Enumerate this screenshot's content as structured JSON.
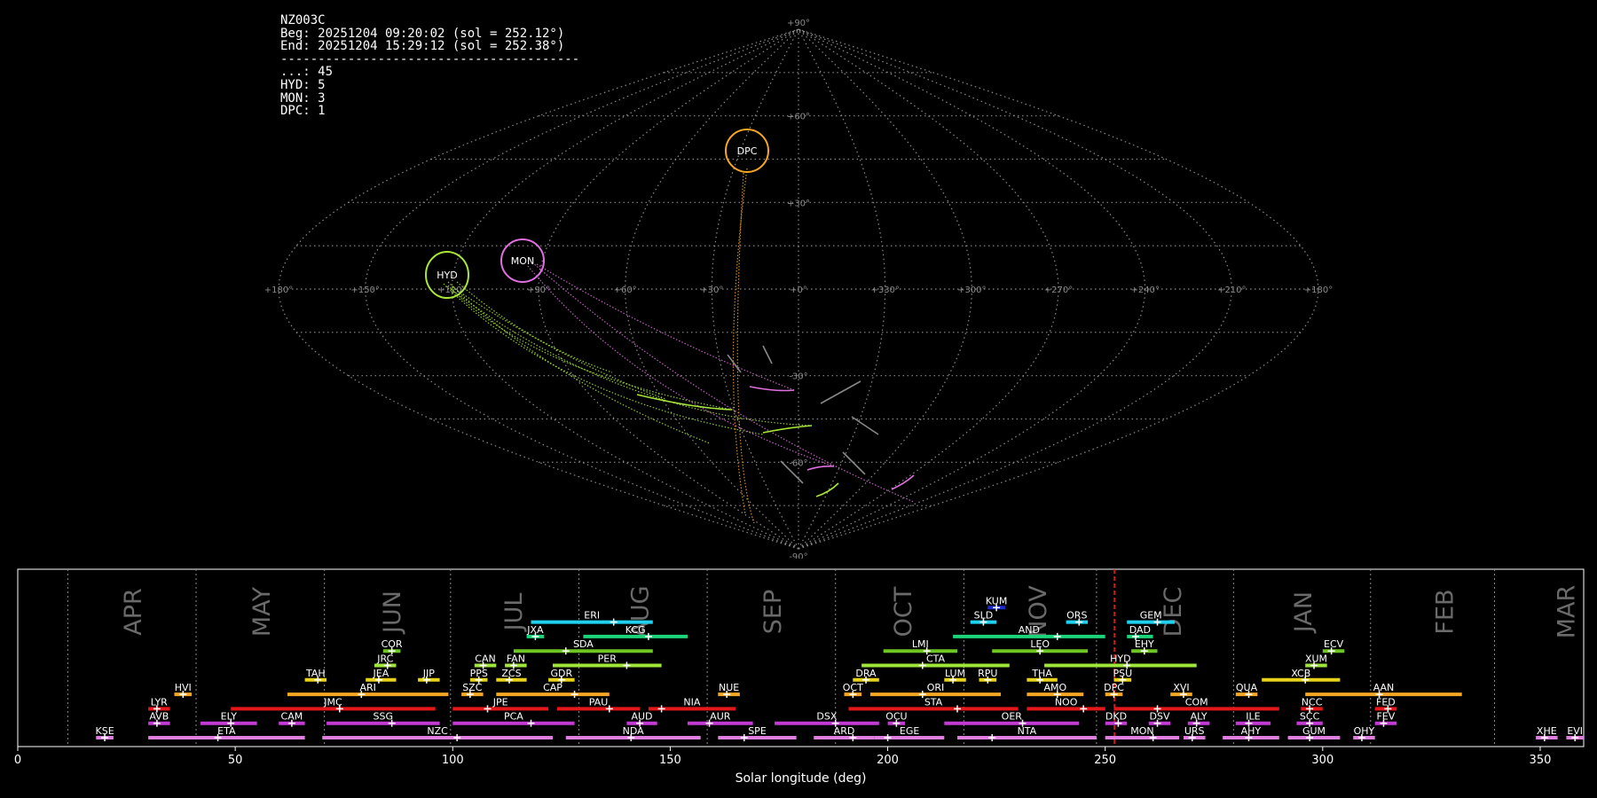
{
  "info": {
    "station": "NZ003C",
    "begin": "Beg: 20251204 09:20:02 (sol = 252.12°)",
    "end": "End: 20251204 15:29:12 (sol = 252.38°)",
    "separator": "----------------------------------------",
    "counts": [
      {
        "code": "...",
        "count": 45
      },
      {
        "code": "HYD",
        "count": 5
      },
      {
        "code": "MON",
        "count": 3
      },
      {
        "code": "DPC",
        "count": 1
      }
    ]
  },
  "sky_map": {
    "projection": "sinusoidal",
    "lon_labels": [
      "+180°",
      "+150°",
      "+120°",
      "+90°",
      "+60°",
      "+30°",
      "+0°",
      "+330°",
      "+300°",
      "+270°",
      "+240°",
      "+210°",
      "+180°"
    ],
    "lat_labels": [
      "+90°",
      "+60°",
      "+30°",
      "-30°",
      "-60°",
      "-90°"
    ],
    "radiants": [
      {
        "code": "HYD",
        "lon": 120,
        "lat": 5,
        "color": "#a8e63a"
      },
      {
        "code": "MON",
        "lon": 93,
        "lat": 15,
        "color": "#e070e0"
      },
      {
        "code": "DPC",
        "lon": 20,
        "lat": 54,
        "color": "#f5a623"
      }
    ]
  },
  "chart_data": {
    "type": "timeline",
    "xlabel": "Solar longitude (deg)",
    "xlim": [
      0,
      360
    ],
    "xticks": [
      0,
      50,
      100,
      150,
      200,
      250,
      300,
      350
    ],
    "current_sol": 252.12,
    "months": [
      {
        "label": "APR",
        "start": 11.5,
        "mid": 24.5
      },
      {
        "label": "MAY",
        "start": 41,
        "mid": 54
      },
      {
        "label": "JUN",
        "start": 70.5,
        "mid": 84
      },
      {
        "label": "JUL",
        "start": 99.5,
        "mid": 112
      },
      {
        "label": "AUG",
        "start": 129,
        "mid": 141
      },
      {
        "label": "SEP",
        "start": 158.5,
        "mid": 171.5
      },
      {
        "label": "OCT",
        "start": 188,
        "mid": 201.5
      },
      {
        "label": "NOV",
        "start": 217.5,
        "mid": 232.5
      },
      {
        "label": "DEC",
        "start": 248,
        "mid": 263.5
      },
      {
        "label": "JAN",
        "start": 279.5,
        "mid": 293.5
      },
      {
        "label": "FEB",
        "start": 311,
        "mid": 326
      },
      {
        "label": "MAR",
        "start": 339.5,
        "mid": 354
      }
    ],
    "showers": [
      {
        "code": "KUM",
        "row": 9,
        "start": 223,
        "end": 227,
        "peak": 225,
        "color": "#1c2bd6"
      },
      {
        "code": "ERI",
        "row": 8,
        "start": 118,
        "end": 146,
        "peak": 137,
        "color": "#1fd3f0"
      },
      {
        "code": "SLD",
        "row": 8,
        "start": 219,
        "end": 225,
        "peak": 222,
        "color": "#1fd3f0"
      },
      {
        "code": "ORS",
        "row": 8,
        "start": 241,
        "end": 246,
        "peak": 244,
        "color": "#1fd3f0"
      },
      {
        "code": "GEM",
        "row": 8,
        "start": 255,
        "end": 266,
        "peak": 262,
        "color": "#1fd3f0"
      },
      {
        "code": "JXA",
        "row": 7,
        "start": 117,
        "end": 121,
        "peak": 119,
        "color": "#1cd47a"
      },
      {
        "code": "KCG",
        "row": 7,
        "start": 130,
        "end": 154,
        "peak": 145,
        "color": "#1cd47a"
      },
      {
        "code": "AND",
        "row": 7,
        "start": 215,
        "end": 250,
        "peak": 239,
        "color": "#1cd47a"
      },
      {
        "code": "DAD",
        "row": 7,
        "start": 255,
        "end": 261,
        "peak": 257,
        "color": "#1cd47a"
      },
      {
        "code": "COR",
        "row": 6,
        "start": 84,
        "end": 88,
        "peak": 86,
        "color": "#6ec623"
      },
      {
        "code": "SDA",
        "row": 6,
        "start": 114,
        "end": 146,
        "peak": 126,
        "color": "#6ec623"
      },
      {
        "code": "LMI",
        "row": 6,
        "start": 199,
        "end": 216,
        "peak": 209,
        "color": "#6ec623"
      },
      {
        "code": "LEO",
        "row": 6,
        "start": 224,
        "end": 246,
        "peak": 235,
        "color": "#6ec623"
      },
      {
        "code": "EHY",
        "row": 6,
        "start": 256,
        "end": 262,
        "peak": 259,
        "color": "#6ec623"
      },
      {
        "code": "ECV",
        "row": 6,
        "start": 300,
        "end": 305,
        "peak": 302,
        "color": "#6ec623"
      },
      {
        "code": "JRC",
        "row": 5,
        "start": 82,
        "end": 87,
        "peak": 85,
        "color": "#9ee63a"
      },
      {
        "code": "CAN",
        "row": 5,
        "start": 105,
        "end": 110,
        "peak": 107,
        "color": "#9ee63a"
      },
      {
        "code": "FAN",
        "row": 5,
        "start": 112,
        "end": 117,
        "peak": 114,
        "color": "#9ee63a"
      },
      {
        "code": "PER",
        "row": 5,
        "start": 123,
        "end": 148,
        "peak": 140,
        "color": "#9ee63a"
      },
      {
        "code": "CTA",
        "row": 5,
        "start": 194,
        "end": 228,
        "peak": 208,
        "color": "#9ee63a"
      },
      {
        "code": "HYD",
        "row": 5,
        "start": 236,
        "end": 271,
        "peak": 255,
        "color": "#9ee63a"
      },
      {
        "code": "XUM",
        "row": 5,
        "start": 296,
        "end": 301,
        "peak": 298,
        "color": "#9ee63a"
      },
      {
        "code": "TAH",
        "row": 4,
        "start": 66,
        "end": 71,
        "peak": 69,
        "color": "#e8d21a"
      },
      {
        "code": "JEA",
        "row": 4,
        "start": 80,
        "end": 87,
        "peak": 83,
        "color": "#e8d21a"
      },
      {
        "code": "JIP",
        "row": 4,
        "start": 92,
        "end": 97,
        "peak": 94,
        "color": "#e8d21a"
      },
      {
        "code": "PPS",
        "row": 4,
        "start": 104,
        "end": 108,
        "peak": 106,
        "color": "#e8d21a"
      },
      {
        "code": "ZCS",
        "row": 4,
        "start": 110,
        "end": 117,
        "peak": 113,
        "color": "#e8d21a"
      },
      {
        "code": "GDR",
        "row": 4,
        "start": 122,
        "end": 128,
        "peak": 125,
        "color": "#e8d21a"
      },
      {
        "code": "DRA",
        "row": 4,
        "start": 192,
        "end": 198,
        "peak": 195,
        "color": "#e8d21a"
      },
      {
        "code": "LUM",
        "row": 4,
        "start": 213,
        "end": 218,
        "peak": 215,
        "color": "#e8d21a"
      },
      {
        "code": "RPU",
        "row": 4,
        "start": 221,
        "end": 225,
        "peak": 223,
        "color": "#e8d21a"
      },
      {
        "code": "THA",
        "row": 4,
        "start": 232,
        "end": 239,
        "peak": 235,
        "color": "#e8d21a"
      },
      {
        "code": "PSU",
        "row": 4,
        "start": 252,
        "end": 256,
        "peak": 254,
        "color": "#e8d21a"
      },
      {
        "code": "XCB",
        "row": 4,
        "start": 286,
        "end": 304,
        "peak": 296,
        "color": "#e8d21a"
      },
      {
        "code": "HVI",
        "row": 3,
        "start": 36,
        "end": 40,
        "peak": 38,
        "color": "#f5a623"
      },
      {
        "code": "ARI",
        "row": 3,
        "start": 62,
        "end": 99,
        "peak": 79,
        "color": "#f5a623"
      },
      {
        "code": "SZC",
        "row": 3,
        "start": 102,
        "end": 107,
        "peak": 104,
        "color": "#f5a623"
      },
      {
        "code": "CAP",
        "row": 3,
        "start": 110,
        "end": 136,
        "peak": 128,
        "color": "#f5a623"
      },
      {
        "code": "NUE",
        "row": 3,
        "start": 161,
        "end": 166,
        "peak": 163,
        "color": "#f5a623"
      },
      {
        "code": "OCT",
        "row": 3,
        "start": 190,
        "end": 194,
        "peak": 192,
        "color": "#f5a623"
      },
      {
        "code": "ORI",
        "row": 3,
        "start": 196,
        "end": 226,
        "peak": 208,
        "color": "#f5a623"
      },
      {
        "code": "AMO",
        "row": 3,
        "start": 232,
        "end": 245,
        "peak": 239,
        "color": "#f5a623"
      },
      {
        "code": "DPC",
        "row": 3,
        "start": 250,
        "end": 254,
        "peak": 252,
        "color": "#f5a623"
      },
      {
        "code": "XVI",
        "row": 3,
        "start": 265,
        "end": 270,
        "peak": 268,
        "color": "#f5a623"
      },
      {
        "code": "QUA",
        "row": 3,
        "start": 280,
        "end": 285,
        "peak": 283,
        "color": "#f5a623"
      },
      {
        "code": "AAN",
        "row": 3,
        "start": 296,
        "end": 332,
        "peak": 313,
        "color": "#f5a623"
      },
      {
        "code": "LYR",
        "row": 2,
        "start": 30,
        "end": 35,
        "peak": 32,
        "color": "#e5171b"
      },
      {
        "code": "JMC",
        "row": 2,
        "start": 49,
        "end": 96,
        "peak": 74,
        "color": "#e5171b"
      },
      {
        "code": "JPE",
        "row": 2,
        "start": 100,
        "end": 122,
        "peak": 108,
        "color": "#e5171b"
      },
      {
        "code": "PAU",
        "row": 2,
        "start": 124,
        "end": 143,
        "peak": 136,
        "color": "#e5171b"
      },
      {
        "code": "NIA",
        "row": 2,
        "start": 145,
        "end": 165,
        "peak": 148,
        "color": "#e5171b"
      },
      {
        "code": "STA",
        "row": 2,
        "start": 191,
        "end": 230,
        "peak": 216,
        "color": "#e5171b"
      },
      {
        "code": "NOO",
        "row": 2,
        "start": 232,
        "end": 250,
        "peak": 245,
        "color": "#e5171b"
      },
      {
        "code": "COM",
        "row": 2,
        "start": 252,
        "end": 290,
        "peak": 262,
        "color": "#e5171b"
      },
      {
        "code": "NCC",
        "row": 2,
        "start": 295,
        "end": 300,
        "peak": 297,
        "color": "#e5171b"
      },
      {
        "code": "FED",
        "row": 2,
        "start": 312,
        "end": 317,
        "peak": 315,
        "color": "#e5171b"
      },
      {
        "code": "AVB",
        "row": 1,
        "start": 30,
        "end": 35,
        "peak": 32,
        "color": "#c33ad4"
      },
      {
        "code": "ELY",
        "row": 1,
        "start": 42,
        "end": 55,
        "peak": 49,
        "color": "#c33ad4"
      },
      {
        "code": "CAM",
        "row": 1,
        "start": 60,
        "end": 66,
        "peak": 63,
        "color": "#c33ad4"
      },
      {
        "code": "SSG",
        "row": 1,
        "start": 71,
        "end": 97,
        "peak": 86,
        "color": "#c33ad4"
      },
      {
        "code": "PCA",
        "row": 1,
        "start": 100,
        "end": 128,
        "peak": 118,
        "color": "#c33ad4"
      },
      {
        "code": "AUD",
        "row": 1,
        "start": 140,
        "end": 147,
        "peak": 143,
        "color": "#c33ad4"
      },
      {
        "code": "AUR",
        "row": 1,
        "start": 154,
        "end": 169,
        "peak": 159,
        "color": "#c33ad4"
      },
      {
        "code": "DSX",
        "row": 1,
        "start": 174,
        "end": 198,
        "peak": 188,
        "color": "#c33ad4"
      },
      {
        "code": "OCU",
        "row": 1,
        "start": 200,
        "end": 204,
        "peak": 202,
        "color": "#c33ad4"
      },
      {
        "code": "OER",
        "row": 1,
        "start": 213,
        "end": 244,
        "peak": 231,
        "color": "#c33ad4"
      },
      {
        "code": "DKD",
        "row": 1,
        "start": 250,
        "end": 255,
        "peak": 253,
        "color": "#c33ad4"
      },
      {
        "code": "DSV",
        "row": 1,
        "start": 260,
        "end": 265,
        "peak": 262,
        "color": "#c33ad4"
      },
      {
        "code": "ALY",
        "row": 1,
        "start": 269,
        "end": 274,
        "peak": 271,
        "color": "#c33ad4"
      },
      {
        "code": "ILE",
        "row": 1,
        "start": 280,
        "end": 288,
        "peak": 283,
        "color": "#c33ad4"
      },
      {
        "code": "SCC",
        "row": 1,
        "start": 294,
        "end": 300,
        "peak": 297,
        "color": "#c33ad4"
      },
      {
        "code": "FEV",
        "row": 1,
        "start": 312,
        "end": 317,
        "peak": 314,
        "color": "#c33ad4"
      },
      {
        "code": "KSE",
        "row": 0,
        "start": 18,
        "end": 22,
        "peak": 20,
        "color": "#e07ee0"
      },
      {
        "code": "ETA",
        "row": 0,
        "start": 30,
        "end": 66,
        "peak": 46,
        "color": "#e07ee0"
      },
      {
        "code": "NZC",
        "row": 0,
        "start": 70,
        "end": 123,
        "peak": 101,
        "color": "#e07ee0"
      },
      {
        "code": "NDA",
        "row": 0,
        "start": 126,
        "end": 157,
        "peak": 141,
        "color": "#e07ee0"
      },
      {
        "code": "SPE",
        "row": 0,
        "start": 161,
        "end": 179,
        "peak": 167,
        "color": "#e07ee0"
      },
      {
        "code": "ARD",
        "row": 0,
        "start": 183,
        "end": 197,
        "peak": 192,
        "color": "#e07ee0"
      },
      {
        "code": "EGE",
        "row": 0,
        "start": 197,
        "end": 213,
        "peak": 200,
        "color": "#e07ee0"
      },
      {
        "code": "NTA",
        "row": 0,
        "start": 216,
        "end": 248,
        "peak": 224,
        "color": "#e07ee0"
      },
      {
        "code": "MON",
        "row": 0,
        "start": 250,
        "end": 267,
        "peak": 261,
        "color": "#e07ee0"
      },
      {
        "code": "URS",
        "row": 0,
        "start": 268,
        "end": 273,
        "peak": 270,
        "color": "#e07ee0"
      },
      {
        "code": "AHY",
        "row": 0,
        "start": 277,
        "end": 290,
        "peak": 283,
        "color": "#e07ee0"
      },
      {
        "code": "GUM",
        "row": 0,
        "start": 292,
        "end": 304,
        "peak": 297,
        "color": "#e07ee0"
      },
      {
        "code": "OHY",
        "row": 0,
        "start": 307,
        "end": 312,
        "peak": 309,
        "color": "#e07ee0"
      },
      {
        "code": "XHE",
        "row": 0,
        "start": 349,
        "end": 354,
        "peak": 351,
        "color": "#e07ee0"
      },
      {
        "code": "EVI",
        "row": 0,
        "start": 356,
        "end": 360,
        "peak": 358,
        "color": "#e07ee0"
      }
    ]
  }
}
